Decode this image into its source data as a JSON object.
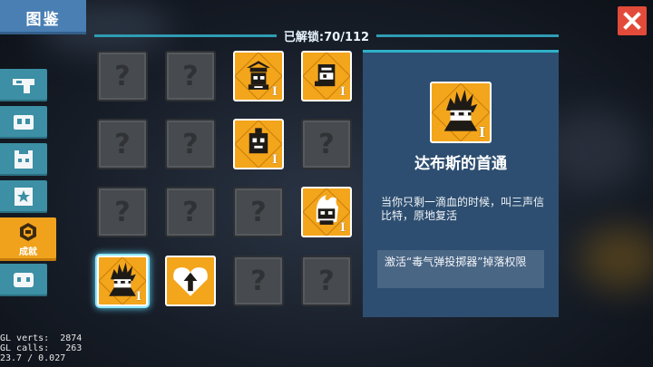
{
  "window": {
    "title": "图鉴",
    "close_icon": "close-icon"
  },
  "header": {
    "unlock_text": "已解锁:70/112"
  },
  "side_tabs": [
    {
      "name": "weapons",
      "icon": "gun-icon"
    },
    {
      "name": "characters",
      "icon": "mask-icon"
    },
    {
      "name": "pets",
      "icon": "pet-icon"
    },
    {
      "name": "skills",
      "icon": "star-icon"
    },
    {
      "name": "achievements",
      "icon": "achievement-icon",
      "label": "成就",
      "active": true
    },
    {
      "name": "other",
      "icon": "other-icon"
    }
  ],
  "grid": [
    {
      "state": "locked",
      "glyph": "?"
    },
    {
      "state": "locked",
      "glyph": "?"
    },
    {
      "state": "unlocked",
      "icon": "hat-character-icon",
      "tier": "I"
    },
    {
      "state": "unlocked",
      "icon": "robot-head-icon",
      "tier": "I"
    },
    {
      "state": "locked",
      "glyph": "?"
    },
    {
      "state": "locked",
      "glyph": "?"
    },
    {
      "state": "unlocked",
      "icon": "block-face-icon",
      "tier": "I"
    },
    {
      "state": "locked",
      "glyph": "?"
    },
    {
      "state": "locked",
      "glyph": "?"
    },
    {
      "state": "locked",
      "glyph": "?"
    },
    {
      "state": "locked",
      "glyph": "?"
    },
    {
      "state": "unlocked",
      "icon": "flame-ghost-icon",
      "tier": "I"
    },
    {
      "state": "unlocked",
      "icon": "spiky-hero-icon",
      "tier": "I",
      "selected": true
    },
    {
      "state": "unlocked",
      "icon": "heart-arrow-icon"
    },
    {
      "state": "locked",
      "glyph": "?"
    },
    {
      "state": "locked",
      "glyph": "?"
    }
  ],
  "detail": {
    "icon": "spiky-hero-icon",
    "tier": "I",
    "name": "达布斯的首通",
    "description": "当你只剩一滴血的时候，叫三声信比特，原地复活",
    "effect": "激活“毒气弹投掷器”掉落权限"
  },
  "debug": {
    "line1": "GL verts:  2874",
    "line2": "GL calls:   263",
    "line3": "23.7 / 0.027"
  },
  "colors": {
    "title_tab": "#4a7fb4",
    "close_button": "#e24b3a",
    "accent_line": "#2f9cb4",
    "side_tab": "#3c8fa4",
    "active_tab": "#f0a21c",
    "card_unlocked": "#f3a51b",
    "card_locked": "#474a4e",
    "detail_panel": "#2d4e70",
    "effect_box": "#4a6685"
  }
}
